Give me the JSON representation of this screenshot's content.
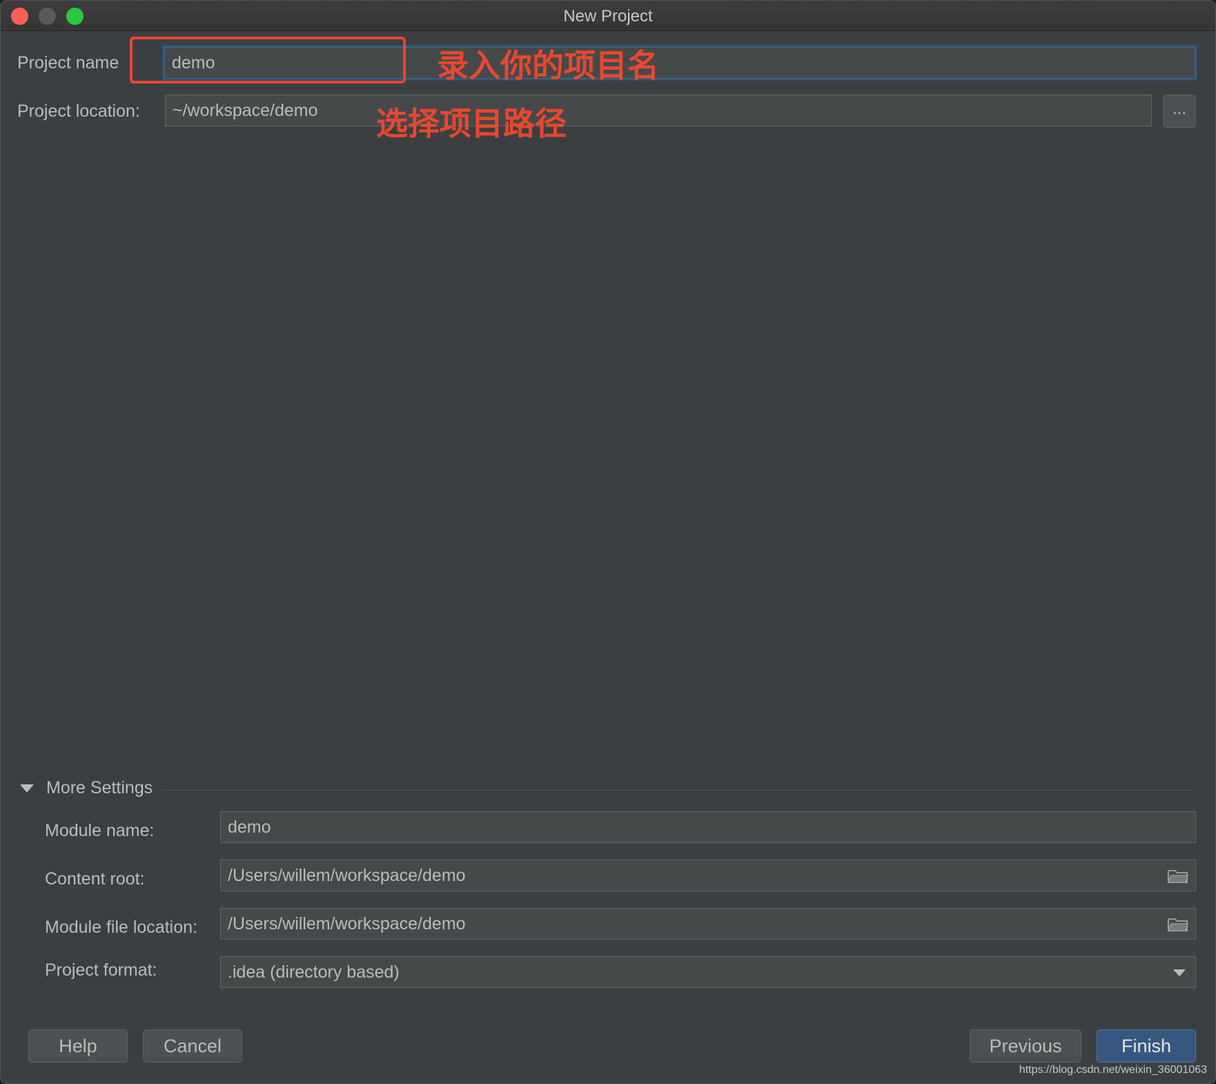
{
  "window": {
    "title": "New Project"
  },
  "project": {
    "name_label": "Project name",
    "name_value": "demo",
    "location_label": "Project location:",
    "location_value": "~/workspace/demo",
    "browse_label": "..."
  },
  "annotations": {
    "name_hint": "录入你的项目名",
    "location_hint": "选择项目路径"
  },
  "more_settings": {
    "title": "More Settings",
    "module_name_label": "Module name:",
    "module_name_value": "demo",
    "content_root_label": "Content root:",
    "content_root_value": "/Users/willem/workspace/demo",
    "module_file_label": "Module file location:",
    "module_file_value": "/Users/willem/workspace/demo",
    "format_label": "Project format:",
    "format_value": ".idea (directory based)"
  },
  "buttons": {
    "help": "Help",
    "cancel": "Cancel",
    "previous": "Previous",
    "finish": "Finish"
  },
  "watermark": "https://blog.csdn.net/weixin_36001063",
  "colors": {
    "background": "#3c3f41",
    "field": "#45494a",
    "annotation": "#e8472f",
    "primary_button": "#365880"
  }
}
